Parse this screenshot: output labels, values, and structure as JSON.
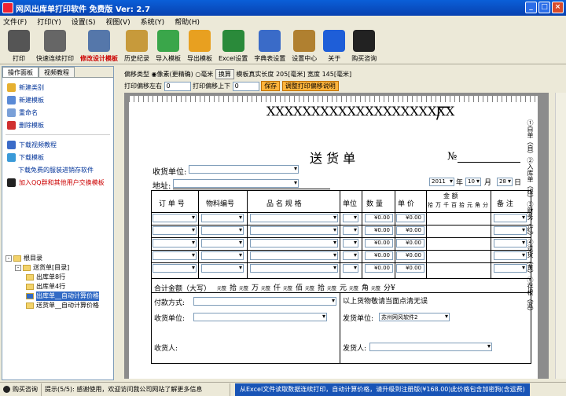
{
  "window": {
    "title": "网风出库单打印软件 免费版   Ver: 2.7"
  },
  "menu": [
    "文件(F)",
    "打印(Y)",
    "设置(S)",
    "视图(V)",
    "系统(Y)",
    "帮助(H)"
  ],
  "toolbar": [
    {
      "label": "打印",
      "icon": "printer-icon",
      "color": "#555"
    },
    {
      "label": "快速连续打印",
      "icon": "fast-print-icon",
      "color": "#666"
    },
    {
      "label": "修改设计模板",
      "icon": "design-ruler-icon",
      "color": "#5577aa",
      "highlight": true
    },
    {
      "label": "历史纪录",
      "icon": "history-icon",
      "color": "#c79a3b"
    },
    {
      "label": "导入模板",
      "icon": "import-arrow-icon",
      "color": "#3aa64a"
    },
    {
      "label": "导出模板",
      "icon": "export-arrow-icon",
      "color": "#e8a020"
    },
    {
      "label": "Excel设置",
      "icon": "excel-icon",
      "color": "#2a8a3a"
    },
    {
      "label": "字典表设置",
      "icon": "address-book-icon",
      "color": "#3a6bc8"
    },
    {
      "label": "设置中心",
      "icon": "tools-icon",
      "color": "#b08030"
    },
    {
      "label": "关于",
      "icon": "info-icon",
      "color": "#1e5ed8"
    },
    {
      "label": "购买咨询",
      "icon": "qq-penguin-icon",
      "color": "#222"
    }
  ],
  "left_panel": {
    "tabs": [
      "操作面板",
      "视频教程"
    ],
    "items": [
      {
        "label": "新建类别",
        "icon": "new-category-icon"
      },
      {
        "label": "新建模板",
        "icon": "new-template-icon"
      },
      {
        "label": "重命名",
        "icon": "rename-icon"
      },
      {
        "label": "删除模板",
        "icon": "delete-icon"
      },
      {
        "label": "下载视频教程",
        "icon": "video-download-icon"
      },
      {
        "label": "下载模板",
        "icon": "download-icon"
      }
    ],
    "link_text": "下载免费的服装进销存软件",
    "qq_text": "加入QQ群和其他用户交换模板",
    "tree": {
      "root": "根目录",
      "group": "送货单[目录]",
      "children": [
        "出库单8行",
        "出库单4行",
        "出库单__自动计算价格",
        "送货单__自动计算价格"
      ],
      "selected_index": 2
    }
  },
  "settings": {
    "offset_type_label": "偏移类型",
    "option_pixel": "像素(更精确)",
    "option_mm": "毫米",
    "convert_button": "换算",
    "paper_length_label": "模板真实长度",
    "paper_length_value": "205[毫米]",
    "width_label": "宽度",
    "width_value": "145[毫米]",
    "left_right_label": "打印偏移左右",
    "left_right_value": "0",
    "up_down_label": "打印偏移上下",
    "up_down_value": "0",
    "save_button": "保存",
    "adjust_button": "调整打印偏移说明"
  },
  "form": {
    "company_placeholder": "XXXXXXXXXXXXXXXXXXXXX",
    "factory_char": "厂",
    "title": "送 货 单",
    "no_label": "№",
    "receiver_unit_label": "收货单位:",
    "address_label": "地址:",
    "date_year": "2011",
    "date_year_suffix": "年",
    "date_month": "10",
    "date_month_suffix": "月",
    "date_day": "28",
    "date_day_suffix": "日",
    "headers": {
      "order_no": "订 单 号",
      "item_no": "物料编号",
      "name_spec": "品 名 规 格",
      "unit": "单位",
      "qty": "数 量",
      "price": "单 价",
      "amount": "金  额",
      "remark": "备 注"
    },
    "amount_digits": [
      "拾",
      "万",
      "千",
      "百",
      "拾",
      "元",
      "角",
      "分"
    ],
    "cell_amount": "¥0.00",
    "total_label": "合计金额（大写）",
    "total_words": [
      "元整",
      "拾",
      "元整",
      "万",
      "元整",
      "仟",
      "元整",
      "佰",
      "元整",
      "拾",
      "元整",
      "元",
      "元整",
      "角",
      "元整",
      "分¥"
    ],
    "payment_label": "付款方式:",
    "confirm_text": "以上货物敬请当面点清无误",
    "receiver_unit2_label": "收货单位:",
    "sender_unit_label": "发货单位:",
    "sender_unit_value": "苏州网风软件2",
    "receiver_label": "收货人:",
    "sender_label": "发货人:",
    "side_text": "①白单（自）②入库单（绿）③财务（红）④送货（黄）⑤存根（蓝）"
  },
  "status": {
    "consult_button": "购买咨询",
    "hint": "提示(5/5): 感谢使用，欢迎访问我公司网站了解更多信息",
    "promo": "从Excel文件读取数据连续打印，自动计算价格，请升级到注册版(¥168.00)此价格包含加密狗(含运费)"
  }
}
